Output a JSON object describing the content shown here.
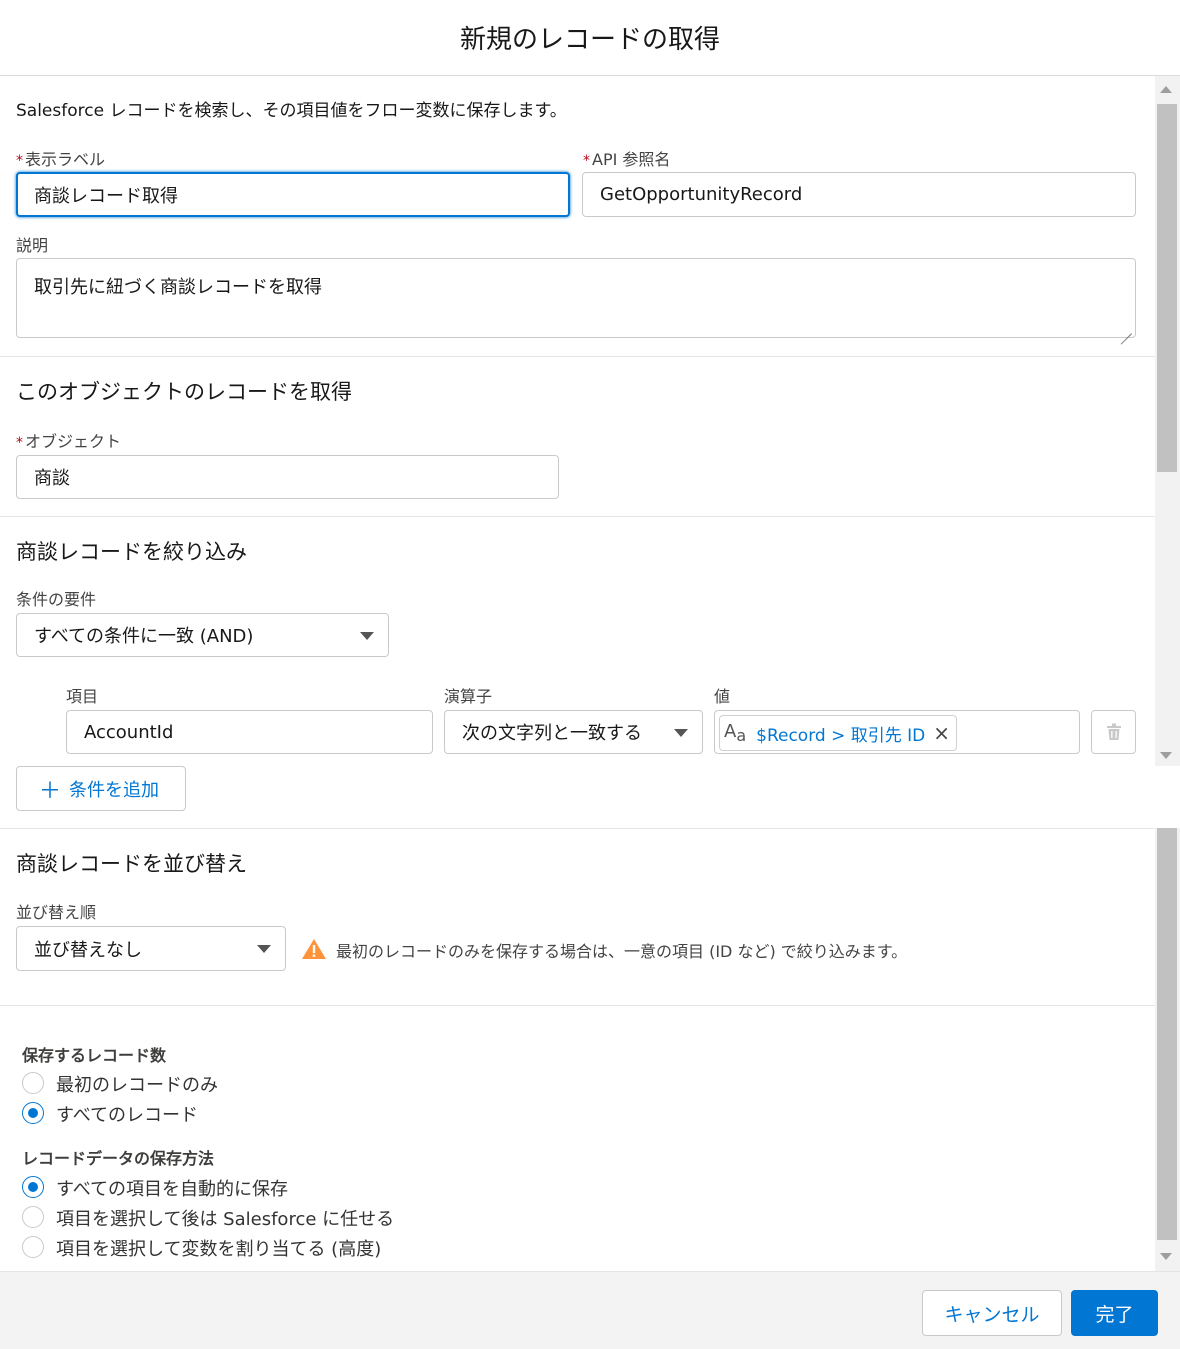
{
  "modal": {
    "title": "新規のレコードの取得"
  },
  "intro": "Salesforce レコードを検索し、その項目値をフロー変数に保存します。",
  "fields": {
    "required_mark": "*",
    "label_label": "表示ラベル",
    "label_value": "商談レコード取得",
    "api_label": "API 参照名",
    "api_value": "GetOpportunityRecord",
    "desc_label": "説明",
    "desc_value": "取引先に紐づく商談レコードを取得"
  },
  "object_section": {
    "heading": "このオブジェクトのレコードを取得",
    "object_label": "オブジェクト",
    "object_value": "商談"
  },
  "filter_section": {
    "heading": "商談レコードを絞り込み",
    "requirement_label": "条件の要件",
    "requirement_value": "すべての条件に一致 (AND)",
    "col_field": "項目",
    "col_operator": "演算子",
    "col_value": "値",
    "row": {
      "field": "AccountId",
      "operator": "次の文字列と一致する",
      "value_prefix": "A",
      "value_prefix_sub": "a",
      "value": "$Record > 取引先 ID",
      "remove": "×"
    },
    "add_condition": "条件を追加",
    "add_icon": "＋"
  },
  "sort_section": {
    "heading": "商談レコードを並び替え",
    "order_label": "並び替え順",
    "order_value": "並び替えなし",
    "warning": "最初のレコードのみを保存する場合は、一意の項目 (ID など) で絞り込みます。"
  },
  "store_section": {
    "count_label": "保存するレコード数",
    "count_options": [
      "最初のレコードのみ",
      "すべてのレコード"
    ],
    "count_selected": 1,
    "method_label": "レコードデータの保存方法",
    "method_options": [
      "すべての項目を自動的に保存",
      "項目を選択して後は Salesforce に任せる",
      "項目を選択して変数を割り当てる (高度)"
    ],
    "method_selected": 0
  },
  "footer": {
    "cancel": "キャンセル",
    "done": "完了"
  },
  "colors": {
    "brand": "#0176d3",
    "required": "#ba0517",
    "warning": "#fe9339"
  }
}
